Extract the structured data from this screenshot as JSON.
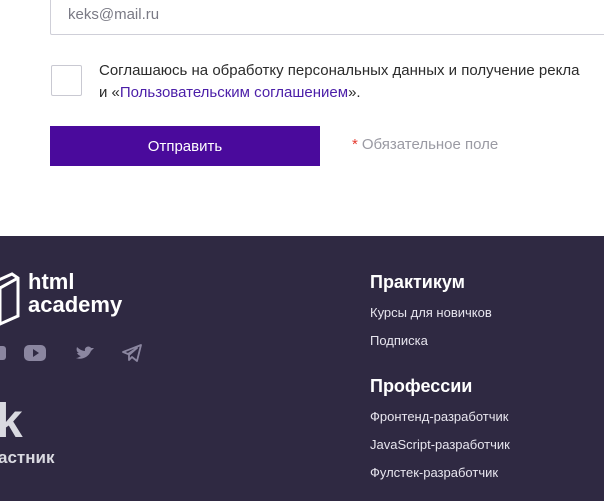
{
  "form": {
    "email_value": "keks@mail.ru",
    "consent_text_1": "Соглашаюсь на обработку персональных данных и получение рекла",
    "consent_text_2_prefix": "и «",
    "consent_link": "Пользовательским соглашением",
    "consent_text_2_suffix": "».",
    "submit_label": "Отправить",
    "required_star": "*",
    "required_label": "Обязательное поле"
  },
  "footer": {
    "logo_line_1": "html",
    "logo_line_2": "academy",
    "social_icons": [
      "vk-icon",
      "youtube-icon",
      "twitter-icon",
      "telegram-icon"
    ],
    "partner_text": "k",
    "partner_sub": "астник",
    "practicum": {
      "title": "Практикум",
      "links": [
        "Курсы для новичков",
        "Подписка"
      ]
    },
    "professions": {
      "title": "Профессии",
      "links": [
        "Фронтенд-разработчик",
        "JavaScript-разработчик",
        "Фулстек-разработчик"
      ]
    }
  },
  "colors": {
    "accent": "#4a0a9c",
    "footer_bg": "#2f2942",
    "link": "#4b1ea8",
    "required_star": "#e53a2f"
  }
}
